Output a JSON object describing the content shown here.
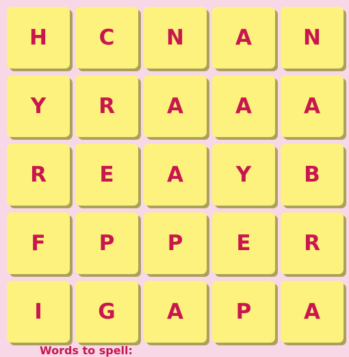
{
  "colors": {
    "background": "#f8d8e6",
    "tile_face": "#fdf27e",
    "tile_shadow": "#a9a15a",
    "letter": "#c8164f",
    "footer_text": "#c8164f"
  },
  "grid": {
    "rows": [
      [
        "H",
        "C",
        "N",
        "A",
        "N"
      ],
      [
        "Y",
        "R",
        "A",
        "A",
        "A"
      ],
      [
        "R",
        "E",
        "A",
        "Y",
        "B"
      ],
      [
        "F",
        "P",
        "P",
        "E",
        "R"
      ],
      [
        "I",
        "G",
        "A",
        "P",
        "A"
      ]
    ]
  },
  "footer": {
    "text": "Words to spell:"
  }
}
